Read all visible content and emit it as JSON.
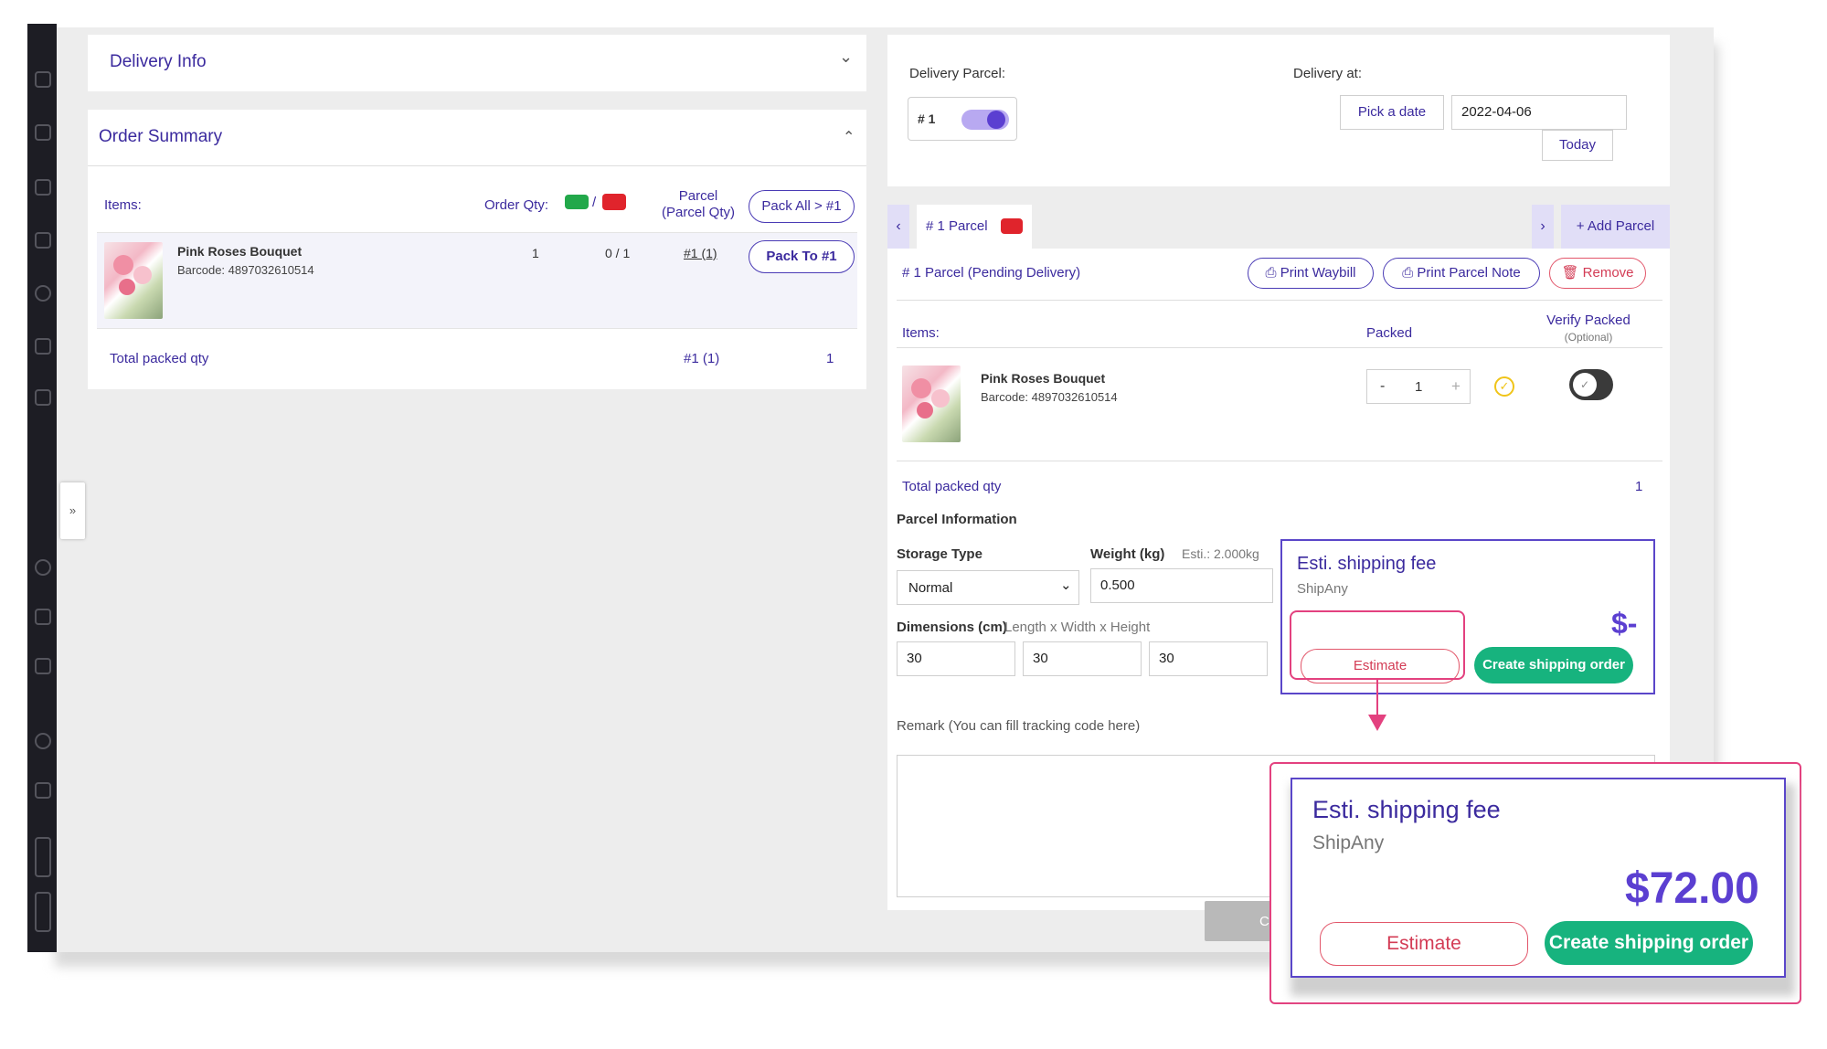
{
  "left": {
    "delivery_info_title": "Delivery Info",
    "order_summary_title": "Order Summary",
    "headers": {
      "items": "Items:",
      "order_qty": "Order Qty:",
      "slash": "/",
      "parcel": "Parcel",
      "parcel_qty": "(Parcel Qty)",
      "pack_all": "Pack All > #1"
    },
    "item": {
      "name": "Pink Roses Bouquet",
      "barcode": "Barcode: 4897032610514",
      "order_qty": "1",
      "ratio": "0 / 1",
      "parcel": "#1 (1)",
      "pack_to": "Pack To #1"
    },
    "total": {
      "label": "Total packed qty",
      "parcel": "#1 (1)",
      "qty": "1"
    }
  },
  "right": {
    "delivery_parcel_label": "Delivery Parcel:",
    "parcel_toggle_label": "# 1",
    "delivery_at_label": "Delivery at:",
    "pick_date": "Pick a date",
    "date_value": "2022-04-06",
    "today": "Today",
    "tab_label": "# 1 Parcel",
    "add_parcel": "+ Add Parcel",
    "parcel_status": "# 1 Parcel (Pending Delivery)",
    "print_waybill": "Print Waybill",
    "print_parcel_note": "Print Parcel Note",
    "remove": "Remove",
    "items_label": "Items:",
    "packed_label": "Packed",
    "verify_packed": "Verify Packed",
    "optional": "(Optional)",
    "item_name": "Pink Roses Bouquet",
    "item_barcode": "Barcode: 4897032610514",
    "stepper_minus": "-",
    "stepper_value": "1",
    "stepper_plus": "+",
    "total_label": "Total packed qty",
    "total_qty": "1",
    "parcel_info_title": "Parcel Information",
    "storage_type_label": "Storage Type",
    "storage_value": "Normal",
    "weight_label": "Weight (kg)",
    "weight_esti": "Esti.: 2.000kg",
    "weight_value": "0.500",
    "dimensions_label": "Dimensions (cm)",
    "dimensions_hint": "Length x Width x Height",
    "length": "30",
    "width": "30",
    "height": "30",
    "fee_title": "Esti. shipping fee",
    "fee_provider": "ShipAny",
    "fee_value": "$-",
    "estimate": "Estimate",
    "create_order": "Create shipping order",
    "remark_label": "Remark (You can fill tracking code here)",
    "footer_cancel_partial": "Ca"
  },
  "callout": {
    "fee_title": "Esti. shipping fee",
    "fee_provider": "ShipAny",
    "fee_value": "$72.00",
    "estimate": "Estimate",
    "create_order": "Create shipping order"
  },
  "colors": {
    "brand_purple": "#3b2a9e",
    "accent_green": "#17b37e",
    "highlight_pink": "#e3417f",
    "danger_red": "#d33c55"
  }
}
